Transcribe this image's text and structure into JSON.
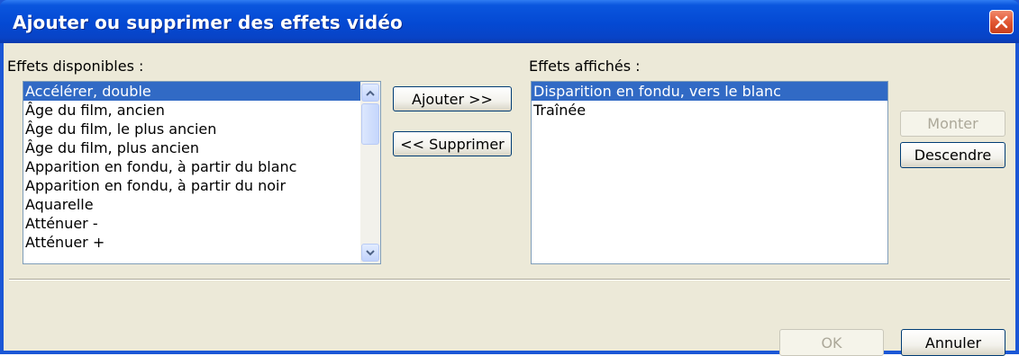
{
  "dialog": {
    "title": "Ajouter ou supprimer des effets vidéo"
  },
  "available": {
    "label": "Effets disponibles :",
    "items": [
      "Accélérer, double",
      "Âge du film, ancien",
      "Âge du film, le plus ancien",
      "Âge du film, plus ancien",
      "Apparition en fondu, à partir du blanc",
      "Apparition en fondu, à partir du noir",
      "Aquarelle",
      "Atténuer -",
      "Atténuer +"
    ],
    "selected_index": 0
  },
  "displayed": {
    "label": "Effets affichés :",
    "items": [
      "Disparition en fondu, vers le blanc",
      "Traînée"
    ],
    "selected_index": 0
  },
  "buttons": {
    "add": "Ajouter >>",
    "remove": "<< Supprimer",
    "move_up": "Monter",
    "move_down": "Descendre",
    "ok": "OK",
    "cancel": "Annuler"
  },
  "colors": {
    "titlebar": "#0449d3",
    "selection": "#316ac5",
    "close": "#e0532f"
  },
  "icons": {
    "close": "close-icon",
    "scroll_up": "scroll-up-arrow-icon",
    "scroll_down": "scroll-down-arrow-icon"
  }
}
